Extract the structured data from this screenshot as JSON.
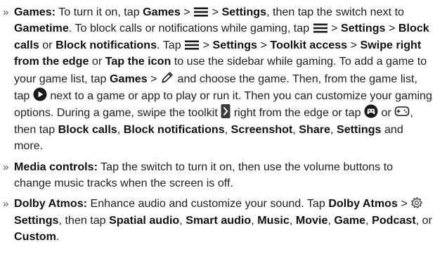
{
  "bullet_marker": "»",
  "colors": {
    "text": "#1f1f1f",
    "icon": "#1a1a1a"
  },
  "games": {
    "title": "Games:",
    "t1": "To turn it on, tap",
    "b_games": "Games",
    "sep": ">",
    "b_settings": "Settings",
    "t2": ", then tap the switch next to",
    "b_gametime": "Gametime",
    "t3": ". To block calls or notifications while gaming, tap",
    "b_block_calls": "Block calls",
    "t_or": "or",
    "b_block_notifications": "Block notifications",
    "t4": ". Tap",
    "b_toolkit_access": "Toolkit access",
    "b_swipe_right": "Swipe right from the edge",
    "b_tap_icon": "Tap the icon",
    "t5": "to use the sidebar while gaming. To add a game to your game list, tap",
    "t6": "and choose the game. Then, from the game list, tap",
    "t7": "next to a game or app to play or run it. Then you can customize your gaming options. During a game, swipe the toolkit",
    "t8": "right from the edge or tap",
    "t9": ", then tap",
    "comma": ",",
    "b_screenshot": "Screenshot",
    "b_share": "Share",
    "t10": "and more.",
    "icons": [
      "menu-icon",
      "pencil-icon",
      "play-circle-icon",
      "toolkit-handle-icon",
      "gamepad-icon",
      "gamepad-outline-icon"
    ]
  },
  "media": {
    "title": "Media controls:",
    "text": "Tap the switch to turn it on, then use the volume buttons to change music tracks when the screen is off."
  },
  "dolby": {
    "title": "Dolby Atmos:",
    "t1": "Enhance audio and customize your sound. Tap",
    "b_dolby_atmos": "Dolby Atmos",
    "sep": ">",
    "b_settings": "Settings",
    "t2": ", then tap",
    "b_spatial": "Spatial audio",
    "b_smart": "Smart audio",
    "b_music": "Music",
    "b_movie": "Movie",
    "b_game": "Game",
    "b_podcast": "Podcast",
    "t_or": ", or",
    "b_custom": "Custom",
    "period": ".",
    "comma": ",",
    "icons": [
      "gear-icon"
    ]
  }
}
